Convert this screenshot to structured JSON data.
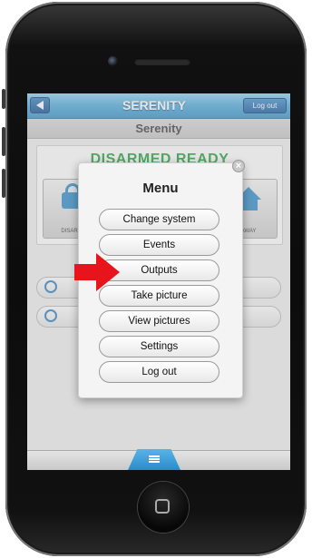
{
  "header": {
    "title": "SERENITY",
    "logout_label": "Log out"
  },
  "subheader": {
    "title": "Serenity"
  },
  "status": {
    "text": "DISARMED  READY",
    "color": "#1f9e3a",
    "disarm_label": "DISARM",
    "away_label": "AWAY"
  },
  "menu": {
    "title": "Menu",
    "close_icon": "close-icon",
    "items": [
      {
        "label": "Change system"
      },
      {
        "label": "Events"
      },
      {
        "label": "Outputs"
      },
      {
        "label": "Take picture"
      },
      {
        "label": "View pictures"
      },
      {
        "label": "Settings"
      },
      {
        "label": "Log out"
      }
    ]
  },
  "annotation": {
    "arrow_color": "#e8141b",
    "points_to": "Outputs"
  },
  "colors": {
    "accent": "#2f90c8",
    "status_green": "#1f9e3a"
  }
}
